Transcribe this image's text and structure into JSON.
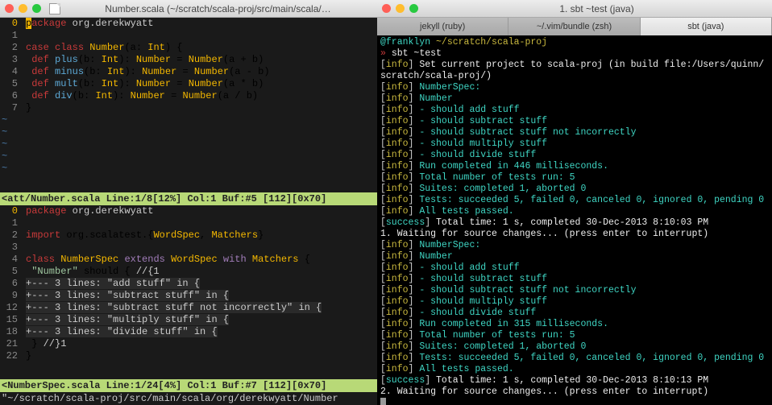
{
  "left": {
    "title": "Number.scala (~/scratch/scala-proj/src/main/scala/…",
    "pane1": {
      "lines": [
        {
          "n": "0",
          "cur": true,
          "html": "<span class='cursor'>p</span><span class='kw'>ackage</span> <span class='pkg'>org.derekwyatt</span>"
        },
        {
          "n": "1",
          "html": ""
        },
        {
          "n": "2",
          "html": "<span class='kw'>case</span> <span class='kw'>class</span> <span class='type'>Number</span>(a: <span class='type'>Int</span>) {"
        },
        {
          "n": "3",
          "html": "  <span class='kw'>def</span> <span class='fn'>plus</span>(b: <span class='type'>Int</span>): <span class='type'>Number</span> = <span class='type'>Number</span>(a + b)"
        },
        {
          "n": "4",
          "html": "  <span class='kw'>def</span> <span class='fn'>minus</span>(b: <span class='type'>Int</span>): <span class='type'>Number</span> = <span class='type'>Number</span>(a - b)"
        },
        {
          "n": "5",
          "html": "  <span class='kw'>def</span> <span class='fn'>mult</span>(b: <span class='type'>Int</span>): <span class='type'>Number</span> = <span class='type'>Number</span>(a * b)"
        },
        {
          "n": "6",
          "html": "  <span class='kw'>def</span> <span class='fn'>div</span>(b: <span class='type'>Int</span>): <span class='type'>Number</span> = <span class='type'>Number</span>(a / b)"
        },
        {
          "n": "7",
          "html": "}"
        }
      ],
      "status": "<att/Number.scala   Line:1/8[12%]  Col:1 Buf:#5 [112][0x70]"
    },
    "pane2": {
      "lines": [
        {
          "n": "0",
          "cur": true,
          "html": "<span class='kw'>package</span> <span class='pkg'>org.derekwyatt</span>"
        },
        {
          "n": "1",
          "html": ""
        },
        {
          "n": "2",
          "html": "<span class='kw'>import</span> org.scalatest.{<span class='type'>WordSpec</span>, <span class='type'>Matchers</span>}"
        },
        {
          "n": "3",
          "html": ""
        },
        {
          "n": "4",
          "html": "<span class='kw'>class</span> <span class='type'>NumberSpec</span> <span class='ext'>extends</span> <span class='type'>WordSpec</span> <span class='ext'>with</span> <span class='type'>Matchers</span> {"
        },
        {
          "n": "5",
          "html": "  <span class='str'>\"Number\"</span> should { <span class='comment'>//{1</span>"
        },
        {
          "n": "6",
          "html": "<span class='fold'>+---  3 lines: \"add stuff\" in {</span>"
        },
        {
          "n": "9",
          "html": "<span class='fold'>+---  3 lines: \"subtract stuff\" in {</span>"
        },
        {
          "n": "12",
          "html": "<span class='fold'>+---  3 lines: \"subtract stuff not incorrectly\" in {</span>"
        },
        {
          "n": "15",
          "html": "<span class='fold'>+---  3 lines: \"multiply stuff\" in {</span>"
        },
        {
          "n": "18",
          "html": "<span class='fold'>+---  3 lines: \"divide stuff\" in {</span>"
        },
        {
          "n": "21",
          "html": "  } <span class='comment'>//}1</span>"
        },
        {
          "n": "22",
          "html": "}"
        }
      ],
      "status": "<NumberSpec.scala   Line:1/24[4%]  Col:1 Buf:#7 [112][0x70]"
    },
    "cmdline": "\"~/scratch/scala-proj/src/main/scala/org/derekwyatt/Number"
  },
  "right": {
    "title": "1. sbt ~test (java)",
    "tabs": [
      {
        "label": "jekyll (ruby)",
        "active": false
      },
      {
        "label": "~/.vim/bundle (zsh)",
        "active": false
      },
      {
        "label": "sbt (java)",
        "active": true
      }
    ],
    "prompt": {
      "user": "@franklyn",
      "path": "~/scratch/scala-proj",
      "cmd": "sbt ~test"
    },
    "lines": [
      "[<span class='ty'>info</span>] <span class='tw'>Set current project to scala-proj (in build file:/Users/quinn/</span>",
      "<span class='tw'>scratch/scala-proj/)</span>",
      "[<span class='ty'>info</span>] <span class='tg'>NumberSpec:</span>",
      "[<span class='ty'>info</span>] <span class='tg'>Number</span>",
      "[<span class='ty'>info</span>] <span class='tg'>- should add stuff</span>",
      "[<span class='ty'>info</span>] <span class='tg'>- should subtract stuff</span>",
      "[<span class='ty'>info</span>] <span class='tg'>- should subtract stuff not incorrectly</span>",
      "[<span class='ty'>info</span>] <span class='tg'>- should multiply stuff</span>",
      "[<span class='ty'>info</span>] <span class='tg'>- should divide stuff</span>",
      "[<span class='ty'>info</span>] <span class='tg'>Run completed in 446 milliseconds.</span>",
      "[<span class='ty'>info</span>] <span class='tg'>Total number of tests run: 5</span>",
      "[<span class='ty'>info</span>] <span class='tg'>Suites: completed 1, aborted 0</span>",
      "[<span class='ty'>info</span>] <span class='tg'>Tests: succeeded 5, failed 0, canceled 0, ignored 0, pending 0</span>",
      "[<span class='ty'>info</span>] <span class='tg'>All tests passed.</span>",
      "[<span class='tg'>success</span>] <span class='tw'>Total time: 1 s, completed 30-Dec-2013 8:10:03 PM</span>",
      "<span class='tw'>1. Waiting for source changes... (press enter to interrupt)</span>",
      "[<span class='ty'>info</span>] <span class='tg'>NumberSpec:</span>",
      "[<span class='ty'>info</span>] <span class='tg'>Number</span>",
      "[<span class='ty'>info</span>] <span class='tg'>- should add stuff</span>",
      "[<span class='ty'>info</span>] <span class='tg'>- should subtract stuff</span>",
      "[<span class='ty'>info</span>] <span class='tg'>- should subtract stuff not incorrectly</span>",
      "[<span class='ty'>info</span>] <span class='tg'>- should multiply stuff</span>",
      "[<span class='ty'>info</span>] <span class='tg'>- should divide stuff</span>",
      "[<span class='ty'>info</span>] <span class='tg'>Run completed in 315 milliseconds.</span>",
      "[<span class='ty'>info</span>] <span class='tg'>Total number of tests run: 5</span>",
      "[<span class='ty'>info</span>] <span class='tg'>Suites: completed 1, aborted 0</span>",
      "[<span class='ty'>info</span>] <span class='tg'>Tests: succeeded 5, failed 0, canceled 0, ignored 0, pending 0</span>",
      "[<span class='ty'>info</span>] <span class='tg'>All tests passed.</span>",
      "[<span class='tg'>success</span>] <span class='tw'>Total time: 1 s, completed 30-Dec-2013 8:10:13 PM</span>",
      "<span class='tw'>2. Waiting for source changes... (press enter to interrupt)</span>"
    ]
  }
}
